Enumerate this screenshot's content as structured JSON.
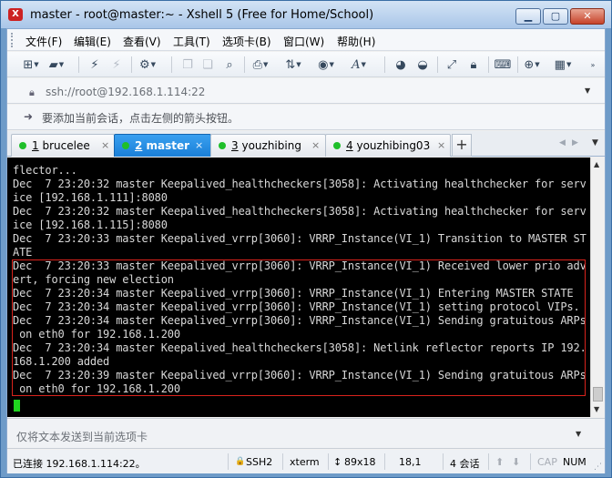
{
  "window": {
    "title": "master - root@master:~ - Xshell 5 (Free for Home/School)",
    "app_icon_glyph": "X",
    "minimize_glyph": "▁",
    "maximize_glyph": "▢",
    "close_glyph": "✕"
  },
  "menu": [
    {
      "label": "文件(F)"
    },
    {
      "label": "编辑(E)"
    },
    {
      "label": "查看(V)"
    },
    {
      "label": "工具(T)"
    },
    {
      "label": "选项卡(B)"
    },
    {
      "label": "窗口(W)"
    },
    {
      "label": "帮助(H)"
    }
  ],
  "toolbar_icons": [
    "new-session-icon",
    "open-folder-icon",
    "connect-icon",
    "disconnect-icon",
    "session-properties-icon",
    "copy-icon",
    "paste-icon",
    "find-icon",
    "print-icon",
    "transfer-icon",
    "globe-icon",
    "font-icon",
    "compose-icon",
    "xftp-icon",
    "fullscreen-icon",
    "lock-icon",
    "keyboard-icon",
    "new-tab-icon",
    "layout-icon"
  ],
  "address": {
    "value": "ssh://root@192.168.1.114:22",
    "lock_glyph": "🔒",
    "dropdown_glyph": "▼"
  },
  "hint": {
    "text": "要添加当前会话，点击左侧的箭头按钮。",
    "icon_glyph": "➜"
  },
  "tabs": [
    {
      "number": "1",
      "name": "brucelee",
      "label": "1 brucelee",
      "active": false
    },
    {
      "number": "2",
      "name": "master",
      "label": "2 master",
      "active": true
    },
    {
      "number": "3",
      "name": "youzhibing",
      "label": "3 youzhibing",
      "active": false
    },
    {
      "number": "4",
      "name": "youzhibing03",
      "label": "4 youzhibing03",
      "active": false
    }
  ],
  "tab_close_glyph": "×",
  "tab_add_glyph": "+",
  "tab_nav": {
    "prev": "◀",
    "next": "▶",
    "menu": "▼"
  },
  "terminal": {
    "lines": [
      "flector...",
      "Dec  7 23:20:32 master Keepalived_healthcheckers[3058]: Activating healthchecker for serv",
      "ice [192.168.1.111]:8080",
      "Dec  7 23:20:32 master Keepalived_healthcheckers[3058]: Activating healthchecker for serv",
      "ice [192.168.1.115]:8080",
      "Dec  7 23:20:33 master Keepalived_vrrp[3060]: VRRP_Instance(VI_1) Transition to MASTER ST",
      "ATE",
      "Dec  7 23:20:33 master Keepalived_vrrp[3060]: VRRP_Instance(VI_1) Received lower prio adv",
      "ert, forcing new election",
      "Dec  7 23:20:34 master Keepalived_vrrp[3060]: VRRP_Instance(VI_1) Entering MASTER STATE",
      "Dec  7 23:20:34 master Keepalived_vrrp[3060]: VRRP_Instance(VI_1) setting protocol VIPs.",
      "Dec  7 23:20:34 master Keepalived_vrrp[3060]: VRRP_Instance(VI_1) Sending gratuitous ARPs",
      " on eth0 for 192.168.1.200",
      "Dec  7 23:20:34 master Keepalived_healthcheckers[3058]: Netlink reflector reports IP 192.",
      "168.1.200 added",
      "Dec  7 23:20:39 master Keepalived_vrrp[3060]: VRRP_Instance(VI_1) Sending gratuitous ARPs",
      " on eth0 for 192.168.1.200"
    ],
    "background": "#000000",
    "text_color": "#d8d8d8",
    "highlight_color": "#d9231c",
    "cursor_color": "#1fd31f"
  },
  "send_bar": {
    "placeholder": "仅将文本发送到当前选项卡",
    "dropdown_glyph": "▼"
  },
  "status": {
    "connection": "已连接 192.168.1.114:22。",
    "protocol": "SSH2",
    "terminal_type": "xterm",
    "size": "89x18",
    "position": "18,1",
    "sessions": "4 会话",
    "caps": "CAP",
    "num": "NUM",
    "arrow_up": "⬆",
    "arrow_down": "⬇",
    "lock_glyph": "🔒",
    "size_glyph": "↕"
  },
  "colors": {
    "active_tab": "#1a7fd8",
    "session_dot": "#1fbf2a"
  }
}
